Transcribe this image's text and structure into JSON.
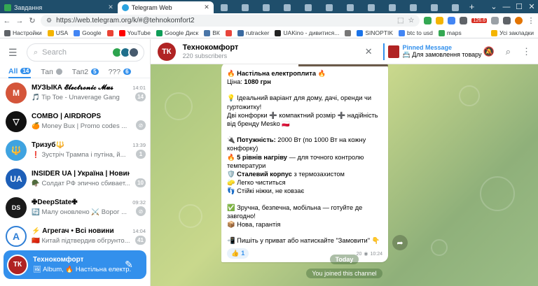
{
  "browser": {
    "tabs": [
      {
        "title": "Завдання",
        "active": false,
        "favicon_color": "#34a853"
      },
      {
        "title": "Telegram Web",
        "active": true,
        "favicon_color": "#2aa3e0"
      }
    ],
    "url": "https://web.telegram.org/k/#@tehnokomfort2",
    "extension_badge": "126.6",
    "bookmarks": [
      {
        "label": "Настройки",
        "color": "#5f6368"
      },
      {
        "label": "USA",
        "color": "#f4b400"
      },
      {
        "label": "Google",
        "color": "#4285f4"
      },
      {
        "label": "",
        "color": "#ea4335"
      },
      {
        "label": "YouTube",
        "color": "#ff0000"
      },
      {
        "label": "Google Диск",
        "color": "#0f9d58"
      },
      {
        "label": "ВК",
        "color": "#4a76a8"
      },
      {
        "label": "",
        "color": "#e8453c"
      },
      {
        "label": "rutracker",
        "color": "#3b6aa0"
      },
      {
        "label": "UAKino - дивитися...",
        "color": "#222222"
      },
      {
        "label": "",
        "color": "#777777"
      },
      {
        "label": "SINOPTIK",
        "color": "#1a73e8"
      },
      {
        "label": "btc to usd",
        "color": "#4285f4"
      },
      {
        "label": "maps",
        "color": "#34a853"
      }
    ],
    "bookmarks_right": "Усі закладки"
  },
  "sidebar": {
    "search_placeholder": "Search",
    "folders": [
      {
        "label": "All",
        "badge": "14",
        "active": true
      },
      {
        "label": "Тап",
        "badge": "",
        "active": false
      },
      {
        "label": "Тап2",
        "badge": "5",
        "active": false
      },
      {
        "label": "???",
        "badge": "6",
        "active": false
      }
    ],
    "chats": [
      {
        "name": "МУЗЫКА 𝓔𝓵𝓮𝓬𝓽𝓻𝓸𝓷𝓲𝓬 𝓜𝓾𝓼",
        "time": "14:01",
        "last": "🎵 Tip Toe - Unaverage Gang",
        "badge": "14",
        "pinned": false,
        "avatar_color": "#d4553a",
        "avatar_text": "М"
      },
      {
        "name": "COMBO | AIRDROPS",
        "time": "",
        "last": "🍊 Money Bux | Promo codes ...",
        "badge": "",
        "pinned": true,
        "avatar_color": "#111111",
        "avatar_text": "▽"
      },
      {
        "name": "Тризуб🔱",
        "time": "13:39",
        "last": "❗ Зустріч Трампа і путіна, й...",
        "badge": "1",
        "pinned": false,
        "avatar_color": "#3fa3e0",
        "avatar_text": "🔱"
      },
      {
        "name": "INSIDER UA | Україна | Новини",
        "time": "",
        "last": "🪖 Солдат РФ эпично сбивает...",
        "badge": "10",
        "pinned": false,
        "avatar_color": "#1d5fb8",
        "avatar_text": "UA"
      },
      {
        "name": "✙DeepState✙",
        "time": "09:32",
        "last": "🔄 Малу оновлено ⚔️ Ворог ...",
        "badge": "",
        "pinned": true,
        "avatar_color": "#1a1a1a",
        "avatar_text": "DS"
      },
      {
        "name": "⚡ Агрегач • Всі новини",
        "time": "14:04",
        "last": "🇨🇳 Китай підтвердив обгрунто...",
        "badge": "41",
        "pinned": false,
        "avatar_color": "#2f7fd6",
        "avatar_text": "A"
      },
      {
        "name": "Технокомфорт",
        "time": "",
        "last": "🖼 Album, 🔥 Настільна електр...",
        "badge": "",
        "pinned": false,
        "avatar_color": "#b02323",
        "avatar_text": "ТК",
        "selected": true
      }
    ]
  },
  "channel": {
    "title": "Технокомфорт",
    "subscribers": "220 subscribers",
    "pinned_label": "Pinned Message",
    "pinned_text": "📇 Для замовлення товару п...",
    "avatar_text": "ТК"
  },
  "message": {
    "title_line": "🔥 Настільна електроплита 🔥",
    "price_label": "Ціна: ",
    "price": "1080 грн",
    "intro1": "💡 Ідеальний варіант для дому, дачі, оренди чи гуртожитку!",
    "intro2": "Дві конфорки ➕ компактний розмір ➕ надійність від бренду Mesko 🇵🇱",
    "power_label": "Потужність:",
    "power_text": " 2000 Вт (по 1000 Вт на кожну конфорку)",
    "levels_label": "5 рівнів нагріву",
    "levels_text": " — для точного контролю температури",
    "body_label": "Сталевий корпус",
    "body_text": " з термозахистом",
    "clean_text": "🧽 Легко чиститься",
    "legs_text": "👣 Стійкі ніжки, не ковзає",
    "safe_text": "✅ Зручна, безпечна, мобільна — готуйте де завгодно!",
    "warranty_text": "📦 Нова, гарантія",
    "cta_text": "📲 Пишіть у приват або натискайте \"Замовити\" 👇",
    "reaction_emoji": "👍",
    "reaction_count": "1",
    "views": "20",
    "time": "10:24"
  },
  "service": {
    "date": "Today",
    "joined": "You joined this channel"
  }
}
